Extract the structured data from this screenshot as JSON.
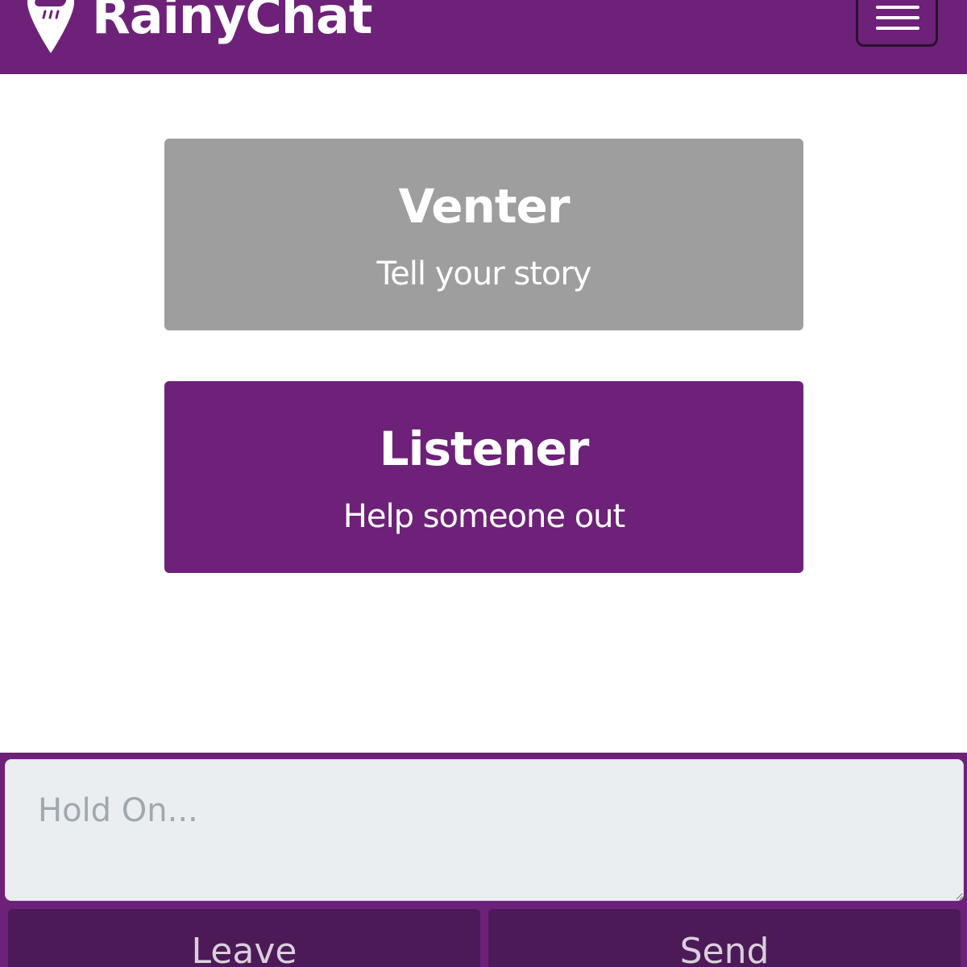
{
  "header": {
    "brand_name": "RainyChat",
    "brand_icon": "raincloud-pin-icon",
    "menu_icon": "hamburger-menu-icon"
  },
  "roles": [
    {
      "title": "Venter",
      "subtitle": "Tell your story"
    },
    {
      "title": "Listener",
      "subtitle": "Help someone out"
    }
  ],
  "chat": {
    "placeholder": "Hold On...",
    "leave_label": "Leave",
    "send_label": "Send"
  },
  "colors": {
    "brand": "#6e2178",
    "dark_brand": "#4d1a58",
    "venter_card": "#9e9e9e",
    "input_bg": "#eaeef0"
  }
}
